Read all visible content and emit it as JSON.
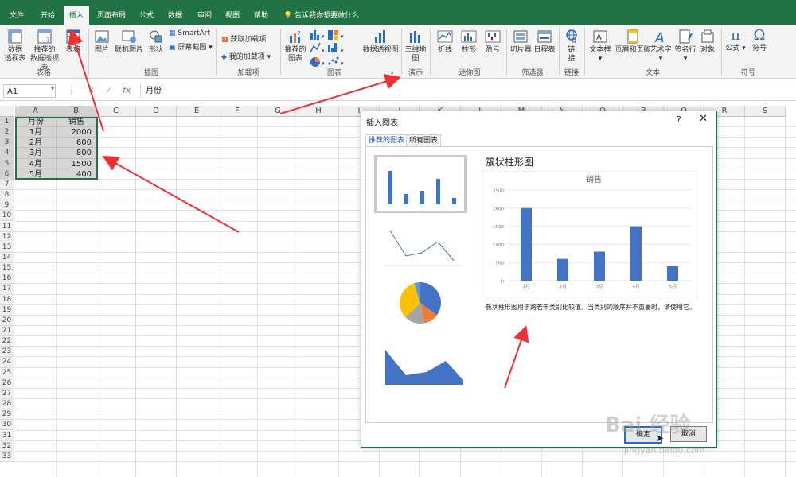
{
  "tabs": [
    "文件",
    "开始",
    "插入",
    "页面布局",
    "公式",
    "数据",
    "审阅",
    "视图",
    "帮助"
  ],
  "active_tab": "插入",
  "tell_me": "告诉我你想要做什么",
  "ribbon": {
    "groups": {
      "tables": "表格",
      "illustrations": "插图",
      "addins": "加载项",
      "charts": "图表",
      "tours": "演示",
      "sparklines": "迷你图",
      "filters": "筛选器",
      "links": "链接",
      "text": "文本",
      "symbols": "符号"
    },
    "pivot_l1": "数据",
    "pivot_l2": "透视表",
    "rec_pivot_l1": "推荐的",
    "rec_pivot_l2": "数据透视表",
    "table": "表格",
    "picture": "图片",
    "online_picture": "联机图片",
    "shapes": "形状",
    "smartart": "SmartArt",
    "screenshot": "屏幕截图",
    "get_addins": "获取加载项",
    "my_addins": "我的加载项",
    "rec_charts_l1": "推荐的",
    "rec_charts_l2": "图表",
    "pivot_chart": "数据透视图",
    "map3d_l1": "三维地",
    "map3d_l2": "图",
    "line": "折线",
    "column": "柱形",
    "winloss": "盈亏",
    "slicer": "切片器",
    "timeline": "日程表",
    "link_l1": "链",
    "link_l2": "接",
    "textbox": "文本框",
    "header_footer": "页眉和页脚",
    "wordart": "艺术字",
    "signature": "签名行",
    "object": "对象",
    "equation": "公式",
    "symbol": "符号"
  },
  "formula_bar": {
    "name_box": "A1",
    "fx": "fx",
    "value": "月份"
  },
  "sheet": {
    "columns": [
      "A",
      "B",
      "C",
      "D",
      "E",
      "F",
      "G",
      "H",
      "I",
      "J",
      "K",
      "L",
      "M",
      "N",
      "O",
      "P",
      "Q",
      "R",
      "S"
    ],
    "rows": 33,
    "header": [
      "月份",
      "销售"
    ],
    "data": [
      [
        "1月",
        "2000"
      ],
      [
        "2月",
        "600"
      ],
      [
        "3月",
        "800"
      ],
      [
        "4月",
        "1500"
      ],
      [
        "5月",
        "400"
      ]
    ]
  },
  "dialog": {
    "title": "插入图表",
    "help": "?",
    "close": "✕",
    "tabs": [
      "推荐的图表",
      "所有图表"
    ],
    "preview_title": "簇状柱形图",
    "description": "簇状柱形图用于跨若干类别比较值。当类别的顺序并不重要时，请使用它。",
    "ok": "确定",
    "cancel": "取消"
  },
  "chart_data": {
    "type": "bar",
    "title": "销售",
    "categories": [
      "1月",
      "2月",
      "3月",
      "4月",
      "5月"
    ],
    "values": [
      2000,
      600,
      800,
      1500,
      400
    ],
    "ylim": [
      0,
      2500
    ],
    "yticks": [
      "0",
      "500",
      "1000",
      "1500",
      "2000",
      "2500"
    ],
    "color": "#4472c4",
    "grid": true
  },
  "watermark": {
    "main": "Bai 经验",
    "sub": "jingyan.baidu.com"
  },
  "colors": {
    "excel_green": "#217346",
    "annotation_red": "#ee3030",
    "bar_blue": "#4472c4"
  }
}
